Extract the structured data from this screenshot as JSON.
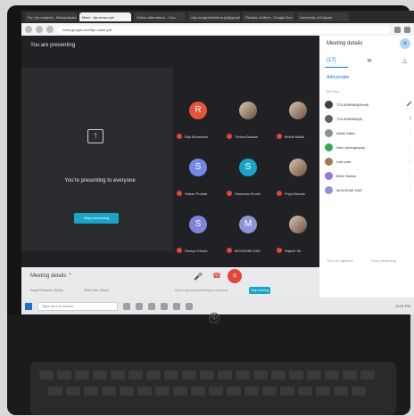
{
  "browser": {
    "tabs": [
      {
        "label": "Fw: (no subject) - Mahavidyalay"
      },
      {
        "label": "Meet - bjo-nmwr-ydt",
        "active": true
      },
      {
        "label": "Online attendance - Goo"
      },
      {
        "label": "cbjc.anugrahkrishna.pk@gmail"
      },
      {
        "label": "Results of Meet - Google Doc"
      },
      {
        "label": "University of Kalyani"
      }
    ],
    "url": "meet.google.com/bjo-nmwr-ydt"
  },
  "meet": {
    "presenting_label": "You are presenting",
    "presenting_message": "You're presenting to everyone",
    "stop_button": "Stop presenting",
    "participants": [
      {
        "initial": "R",
        "name": "Riju Bhowmick",
        "color": "#e5533d"
      },
      {
        "initial": "",
        "name": "Tuhina Biswas",
        "color": "#b58b6a"
      },
      {
        "initial": "",
        "name": "Mohiti Mallik",
        "color": "#c7a07b"
      },
      {
        "initial": "S",
        "name": "Sabari Poddar",
        "color": "#7289e6"
      },
      {
        "initial": "S",
        "name": "Samama Ghosh",
        "color": "#1aa5c8"
      },
      {
        "initial": "",
        "name": "Priya Biswas",
        "color": "#b3936f"
      },
      {
        "initial": "S",
        "name": "Shreya Ghosh",
        "color": "#7d86d8"
      },
      {
        "initial": "M",
        "name": "MOUSUMI DAS",
        "color": "#8d95d6"
      },
      {
        "initial": "",
        "name": "Rajesh Sk",
        "color": "#c9b39a"
      }
    ]
  },
  "sidepanel": {
    "title": "Meeting details",
    "tabs": {
      "people": "(17)",
      "chat": "✉",
      "activities": "△"
    },
    "add_people": "Add people",
    "in_call": "IN CALL",
    "people": [
      {
        "name": "TOLAVARMA(Rohit)",
        "sub": "",
        "color": "#3c4043"
      },
      {
        "name": "TOLAVARMA(B)",
        "sub": "You are presenting",
        "color": "#5f6368"
      },
      {
        "name": "Abhik Saha",
        "sub": "",
        "color": "#8a8f98"
      },
      {
        "name": "Hero photography",
        "sub": "",
        "color": "#34a853"
      },
      {
        "name": "Link poet",
        "sub": "",
        "color": "#9e7b54"
      },
      {
        "name": "Bhim Sarkar",
        "sub": "",
        "color": "#8e7bd9"
      },
      {
        "name": "MOUSUMI DAS",
        "sub": "",
        "color": "#8d95d6"
      }
    ],
    "footer": {
      "left": "Turn on captions",
      "right": "Stop presenting"
    }
  },
  "bottombar": {
    "meeting_details": "Meeting details ⌃",
    "thumbs": [
      {
        "name": "Ranjit Pramanik",
        "sub": "(Mute)"
      },
      {
        "name": "Rohit Kale",
        "sub": "(Mute)"
      }
    ],
    "presenting_hint": "Anna Lalana is presenting to everyone",
    "presenting_chip": "Stop sharing"
  },
  "taskbar": {
    "search": "Type here to search",
    "time": "12:01 PM"
  },
  "logo": {
    "hp": "hp"
  }
}
